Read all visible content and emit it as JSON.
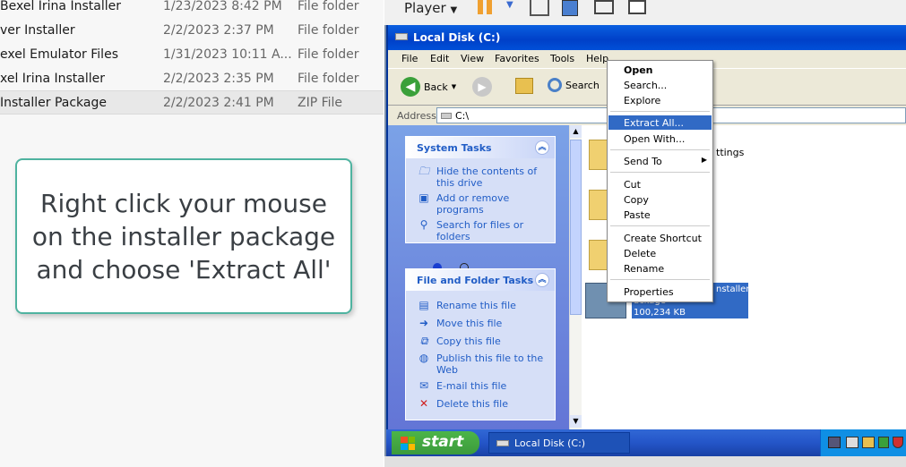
{
  "explorer_list": {
    "rows": [
      {
        "name": "Bexel Irina Installer",
        "date": "1/23/2023 8:42 PM",
        "type": "File folder"
      },
      {
        "name": "ver Installer",
        "date": "2/2/2023 2:37 PM",
        "type": "File folder"
      },
      {
        "name": "exel Emulator Files",
        "date": "1/31/2023 10:11 A...",
        "type": "File folder"
      },
      {
        "name": "xel Irina Installer",
        "date": "2/2/2023 2:35 PM",
        "type": "File folder"
      },
      {
        "name": "Installer Package",
        "date": "2/2/2023 2:41 PM",
        "type": "ZIP File"
      }
    ]
  },
  "callout": {
    "text": "Right click your mouse on the installer package and choose 'Extract All'"
  },
  "vm_toolbar": {
    "player_label": "Player"
  },
  "window": {
    "title": "Local Disk (C:)",
    "menu": [
      "File",
      "Edit",
      "View",
      "Favorites",
      "Tools",
      "Help"
    ],
    "toolbar": {
      "back_label": "Back",
      "search_label": "Search"
    },
    "address": {
      "label": "Address",
      "value": "C:\\"
    }
  },
  "system_tasks": {
    "title": "System Tasks",
    "items": [
      "Hide the contents of this drive",
      "Add or remove programs",
      "Search for files or folders"
    ]
  },
  "file_folder_tasks": {
    "title": "File and Folder Tasks",
    "items": [
      "Rename this file",
      "Move this file",
      "Copy this file",
      "Publish this file to the Web",
      "E-mail this file",
      "Delete this file"
    ]
  },
  "content": {
    "folder_partial_label": "ttings",
    "selected_file": {
      "name_partial": "nstaller",
      "name_line2": "ackage",
      "size": "100,234 KB"
    }
  },
  "context_menu": {
    "items": [
      "Open",
      "Search...",
      "Explore",
      "Extract All...",
      "Open With...",
      "Send To",
      "Cut",
      "Copy",
      "Paste",
      "Create Shortcut",
      "Delete",
      "Rename",
      "Properties"
    ]
  },
  "taskbar": {
    "start_label": "start",
    "task_label": "Local Disk (C:)"
  },
  "colors": {
    "callout_border": "#4fb3a0",
    "xp_blue": "#0040c8",
    "highlight": "#316ac5"
  }
}
